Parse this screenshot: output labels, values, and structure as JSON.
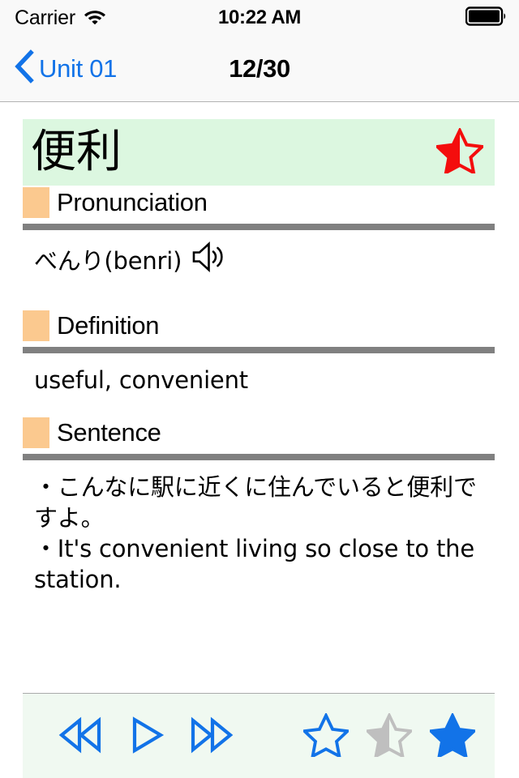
{
  "status_bar": {
    "carrier": "Carrier",
    "wifi_icon": "wifi-icon",
    "time": "10:22 AM",
    "battery_icon": "battery-full-icon"
  },
  "nav_bar": {
    "back_icon": "chevron-left-icon",
    "back_label": "Unit 01",
    "title": "12/30"
  },
  "word_card": {
    "word": "便利",
    "favorite_icon": "star-half-icon",
    "favorite_color": "#f40d0d",
    "background_color": "#dcf7e0"
  },
  "sections": [
    {
      "title": "Pronunciation",
      "bullet_color": "#fbc98f",
      "rule_color": "#808080",
      "body": "べんり(benri)",
      "audio_icon": "speaker-icon"
    },
    {
      "title": "Definition",
      "bullet_color": "#fbc98f",
      "rule_color": "#808080",
      "body": "useful, convenient"
    },
    {
      "title": "Sentence",
      "bullet_color": "#fbc98f",
      "rule_color": "#808080",
      "body": "・こんなに駅に近くに住んでいると便利ですよ。\n・It's convenient living so close to the station."
    }
  ],
  "toolbar": {
    "background_color": "#f0f9f1",
    "accent_color": "#1273e8",
    "inactive_color": "#bfbfbf",
    "buttons": [
      {
        "name": "rewind-button",
        "icon": "rewind-icon",
        "state": "outline"
      },
      {
        "name": "play-button",
        "icon": "play-icon",
        "state": "outline"
      },
      {
        "name": "fast-forward-button",
        "icon": "fast-forward-icon",
        "state": "outline"
      },
      {
        "name": "star-empty-button",
        "icon": "star-outline-icon",
        "state": "empty"
      },
      {
        "name": "star-half-button",
        "icon": "star-half-icon",
        "state": "half"
      },
      {
        "name": "star-full-button",
        "icon": "star-filled-icon",
        "state": "filled"
      }
    ]
  }
}
